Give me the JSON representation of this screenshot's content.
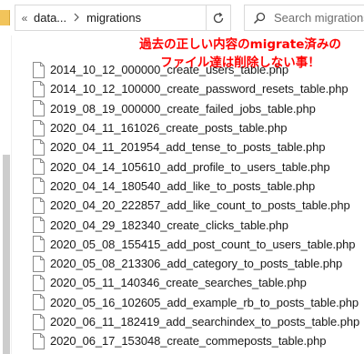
{
  "window": {
    "breadcrumb": {
      "overflow_glyph": "«",
      "items": [
        "data...",
        "migrations"
      ]
    },
    "search": {
      "placeholder": "Search migrations"
    }
  },
  "annotation": {
    "lines": [
      "過去の正しい内容のmigrate済みの",
      "ファイル達は削除しない事！"
    ],
    "color": "#ff0000"
  },
  "files": [
    "2014_10_12_000000_create_users_table.php",
    "2014_10_12_100000_create_password_resets_table.php",
    "2019_08_19_000000_create_failed_jobs_table.php",
    "2020_04_11_161026_create_posts_table.php",
    "2020_04_11_201954_add_tense_to_posts_table.php",
    "2020_04_14_105610_add_profile_to_users_table.php",
    "2020_04_14_180540_add_like_to_posts_table.php",
    "2020_04_20_222857_add_like_count_to_posts_table.php",
    "2020_04_29_182340_create_clicks_table.php",
    "2020_05_08_155415_add_post_count_to_users_table.php",
    "2020_05_08_213306_add_category_to_posts_table.php",
    "2020_05_11_140346_create_searches_table.php",
    "2020_05_16_102605_add_example_rb_to_posts_table.php",
    "2020_06_11_182419_add_searchindex_to_posts_table.php",
    "2020_06_17_153048_create_commeposts_table.php"
  ],
  "icons": {
    "file": "php-file-icon",
    "search": "search-icon",
    "refresh": "refresh-icon",
    "dropdown": "chevron-down-icon",
    "separator": "chevron-right-icon"
  }
}
